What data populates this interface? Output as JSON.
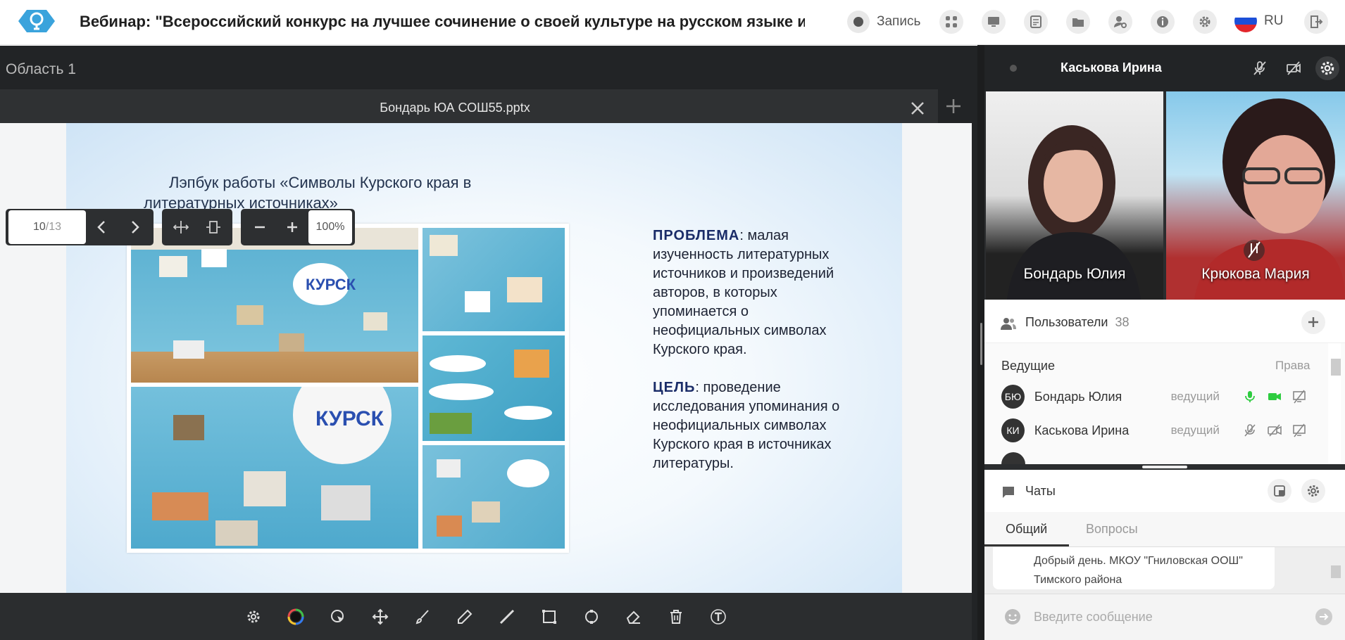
{
  "header": {
    "title": "Вебинар: \"Всероссийский конкурс на лучшее сочинение о своей культуре на русском языке и лучшее ...",
    "record_label": "Запись",
    "lang": "RU",
    "icons": [
      "apps-icon",
      "screen-share-icon",
      "document-icon",
      "folder-icon",
      "user-settings-icon",
      "info-icon",
      "settings-icon"
    ]
  },
  "workspace": {
    "area_label": "Область 1",
    "file_name": "Бондарь ЮА СОШ55.pptx"
  },
  "viewer": {
    "page_current": "10",
    "page_total": "/13",
    "zoom": "100%"
  },
  "slide": {
    "title": "Лэпбук работы «Символы Курского края в литературных источниках»",
    "problem_label": "ПРОБЛЕМА",
    "problem_text": ": малая изученность литературных источников и произведений авторов, в которых упоминается о неофициальных символах Курского края.",
    "goal_label": "ЦЕЛЬ",
    "goal_text": ": проведение исследования упоминания о неофициальных символах Курского края в источниках литературы."
  },
  "draw_tools": [
    "settings-icon",
    "color-picker-icon",
    "pointer-icon",
    "move-icon",
    "brush-icon",
    "pen-icon",
    "line-icon",
    "rectangle-icon",
    "shape-icon",
    "eraser-icon",
    "trash-icon",
    "text-icon"
  ],
  "right": {
    "current_user": "Каськова Ирина",
    "videos": [
      {
        "name": "Бондарь Юлия"
      },
      {
        "name": "Крюкова Мария"
      }
    ],
    "users_title": "Пользователи",
    "users_count": "38",
    "hosts_label": "Ведущие",
    "rights_label": "Права",
    "users": [
      {
        "initials": "БЮ",
        "name": "Бондарь Юлия",
        "role": "ведущий"
      },
      {
        "initials": "КИ",
        "name": "Каськова Ирина",
        "role": "ведущий"
      }
    ],
    "chats_title": "Чаты",
    "tab_general": "Общий",
    "tab_questions": "Вопросы",
    "message": "Добрый день. МКОУ \"Гниловская ООШ\" Тимского района",
    "input_placeholder": "Введите сообщение"
  },
  "colors": {
    "logo": "#3aa3dc",
    "accent_green": "#2ecc40",
    "dark": "#222426"
  }
}
